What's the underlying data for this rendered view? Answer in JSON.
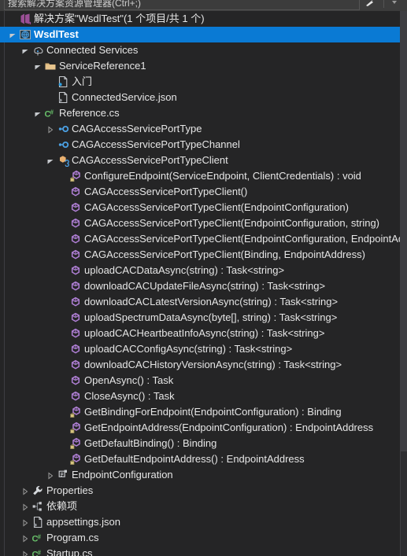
{
  "search": {
    "placeholder": "搜索解决方案资源管理器(Ctrl+;)",
    "value": "",
    "icon": "search-icon",
    "dropdown_icon": "chevron-down-icon"
  },
  "tree": {
    "rows": [
      {
        "depth": 0,
        "twisty": "none",
        "icon": "visual-studio-solution-icon",
        "label": "解决方案\"WsdlTest\"(1 个项目/共 1 个)",
        "selected": false,
        "name": "tree-row-solution"
      },
      {
        "depth": 0,
        "twisty": "expanded",
        "icon": "web-project-icon",
        "label": "WsdlTest",
        "selected": true,
        "name": "tree-row-project-wsdltest"
      },
      {
        "depth": 1,
        "twisty": "expanded",
        "icon": "connected-services-icon",
        "label": "Connected Services",
        "selected": false,
        "name": "tree-row-connected-services"
      },
      {
        "depth": 2,
        "twisty": "expanded",
        "icon": "folder-icon",
        "label": "ServiceReference1",
        "selected": false,
        "name": "tree-row-servicereference1"
      },
      {
        "depth": 3,
        "twisty": "none",
        "icon": "file-blue-icon",
        "label": "入门",
        "selected": false,
        "name": "tree-row-getting-started"
      },
      {
        "depth": 3,
        "twisty": "none",
        "icon": "file-json-icon",
        "label": "ConnectedService.json",
        "selected": false,
        "name": "tree-row-connectedservice-json"
      },
      {
        "depth": 2,
        "twisty": "expanded",
        "icon": "csharp-icon",
        "label": "Reference.cs",
        "selected": false,
        "name": "tree-row-reference-cs"
      },
      {
        "depth": 3,
        "twisty": "collapsed",
        "icon": "interface-icon",
        "label": "CAGAccessServicePortType",
        "selected": false,
        "name": "tree-row-interface-portType"
      },
      {
        "depth": 3,
        "twisty": "none",
        "icon": "interface-icon",
        "label": "CAGAccessServicePortTypeChannel",
        "selected": false,
        "name": "tree-row-interface-portTypeChannel"
      },
      {
        "depth": 3,
        "twisty": "expanded",
        "icon": "class-icon",
        "label": "CAGAccessServicePortTypeClient",
        "selected": false,
        "name": "tree-row-class-portTypeClient"
      },
      {
        "depth": 4,
        "twisty": "none",
        "icon": "method-private-icon",
        "label": "ConfigureEndpoint(ServiceEndpoint, ClientCredentials) : void",
        "selected": false,
        "name": "tree-row-method-configureendpoint"
      },
      {
        "depth": 4,
        "twisty": "none",
        "icon": "method-icon",
        "label": "CAGAccessServicePortTypeClient()",
        "selected": false,
        "name": "tree-row-ctor-0"
      },
      {
        "depth": 4,
        "twisty": "none",
        "icon": "method-icon",
        "label": "CAGAccessServicePortTypeClient(EndpointConfiguration)",
        "selected": false,
        "name": "tree-row-ctor-1"
      },
      {
        "depth": 4,
        "twisty": "none",
        "icon": "method-icon",
        "label": "CAGAccessServicePortTypeClient(EndpointConfiguration, string)",
        "selected": false,
        "name": "tree-row-ctor-2"
      },
      {
        "depth": 4,
        "twisty": "none",
        "icon": "method-icon",
        "label": "CAGAccessServicePortTypeClient(EndpointConfiguration, EndpointAddress)",
        "selected": false,
        "name": "tree-row-ctor-3"
      },
      {
        "depth": 4,
        "twisty": "none",
        "icon": "method-icon",
        "label": "CAGAccessServicePortTypeClient(Binding, EndpointAddress)",
        "selected": false,
        "name": "tree-row-ctor-4"
      },
      {
        "depth": 4,
        "twisty": "none",
        "icon": "method-icon",
        "label": "uploadCACDataAsync(string) : Task<string>",
        "selected": false,
        "name": "tree-row-method-uploadcacdataasync"
      },
      {
        "depth": 4,
        "twisty": "none",
        "icon": "method-icon",
        "label": "downloadCACUpdateFileAsync(string) : Task<string>",
        "selected": false,
        "name": "tree-row-method-downloadcacupdatefileasync"
      },
      {
        "depth": 4,
        "twisty": "none",
        "icon": "method-icon",
        "label": "downloadCACLatestVersionAsync(string) : Task<string>",
        "selected": false,
        "name": "tree-row-method-downloadcaclatestversionasync"
      },
      {
        "depth": 4,
        "twisty": "none",
        "icon": "method-icon",
        "label": "uploadSpectrumDataAsync(byte[], string) : Task<string>",
        "selected": false,
        "name": "tree-row-method-uploadspectrumdataasync"
      },
      {
        "depth": 4,
        "twisty": "none",
        "icon": "method-icon",
        "label": "uploadCACHeartbeatInfoAsync(string) : Task<string>",
        "selected": false,
        "name": "tree-row-method-uploadcacheartbeatinfoasync"
      },
      {
        "depth": 4,
        "twisty": "none",
        "icon": "method-icon",
        "label": "uploadCACConfigAsync(string) : Task<string>",
        "selected": false,
        "name": "tree-row-method-uploadcacconfigasync"
      },
      {
        "depth": 4,
        "twisty": "none",
        "icon": "method-icon",
        "label": "downloadCACHistoryVersionAsync(string) : Task<string>",
        "selected": false,
        "name": "tree-row-method-downloadcachistoryversionasync"
      },
      {
        "depth": 4,
        "twisty": "none",
        "icon": "method-icon",
        "label": "OpenAsync() : Task",
        "selected": false,
        "name": "tree-row-method-openasync"
      },
      {
        "depth": 4,
        "twisty": "none",
        "icon": "method-icon",
        "label": "CloseAsync() : Task",
        "selected": false,
        "name": "tree-row-method-closeasync"
      },
      {
        "depth": 4,
        "twisty": "none",
        "icon": "method-private-icon",
        "label": "GetBindingForEndpoint(EndpointConfiguration) : Binding",
        "selected": false,
        "name": "tree-row-method-getbindingforendpoint"
      },
      {
        "depth": 4,
        "twisty": "none",
        "icon": "method-private-icon",
        "label": "GetEndpointAddress(EndpointConfiguration) : EndpointAddress",
        "selected": false,
        "name": "tree-row-method-getendpointaddress"
      },
      {
        "depth": 4,
        "twisty": "none",
        "icon": "method-private-icon",
        "label": "GetDefaultBinding() : Binding",
        "selected": false,
        "name": "tree-row-method-getdefaultbinding"
      },
      {
        "depth": 4,
        "twisty": "none",
        "icon": "method-private-icon",
        "label": "GetDefaultEndpointAddress() : EndpointAddress",
        "selected": false,
        "name": "tree-row-method-getdefaultendpointaddress"
      },
      {
        "depth": 3,
        "twisty": "collapsed",
        "icon": "enum-icon",
        "label": "EndpointConfiguration",
        "selected": false,
        "name": "tree-row-enum-endpointconfiguration"
      },
      {
        "depth": 1,
        "twisty": "collapsed",
        "icon": "properties-icon",
        "label": "Properties",
        "selected": false,
        "name": "tree-row-properties"
      },
      {
        "depth": 1,
        "twisty": "collapsed",
        "icon": "dependencies-icon",
        "label": "依赖项",
        "selected": false,
        "name": "tree-row-dependencies"
      },
      {
        "depth": 1,
        "twisty": "collapsed",
        "icon": "file-json-icon",
        "label": "appsettings.json",
        "selected": false,
        "name": "tree-row-appsettings-json"
      },
      {
        "depth": 1,
        "twisty": "collapsed",
        "icon": "csharp-icon",
        "label": "Program.cs",
        "selected": false,
        "name": "tree-row-program-cs"
      },
      {
        "depth": 1,
        "twisty": "collapsed",
        "icon": "csharp-icon",
        "label": "Startup.cs",
        "selected": false,
        "name": "tree-row-startup-cs"
      }
    ]
  },
  "scrollbar": {
    "orientation": "vertical",
    "thumb_top_pct": 0,
    "thumb_height_pct": 81
  },
  "colors": {
    "background": "#252526",
    "selection": "#0a7ad4",
    "text": "#e6e6e6",
    "interface": "#4ba0e3",
    "class": "#e8b070",
    "method": "#b180d7",
    "csharp": "#68c06a",
    "folder": "#dcb67a",
    "solution": "#9b4f96"
  }
}
